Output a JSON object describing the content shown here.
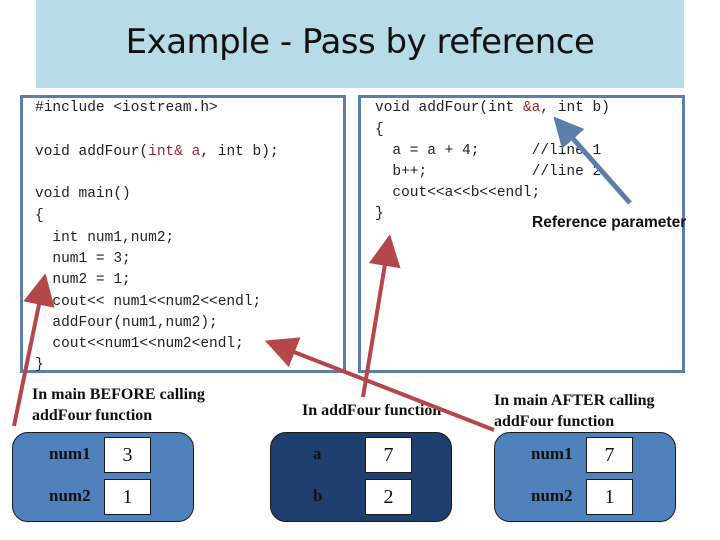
{
  "title": "Example - Pass by reference",
  "left_code": {
    "lines": [
      "#include <iostream.h>",
      "void addFour(",
      "int& a",
      ", int b);",
      "void main()",
      "{",
      "  int num1,num2;",
      "  num1 = 3;",
      "  num2 = 1;",
      "  cout<< num1<<num2<<endl;",
      "  addFour(num1,num2);",
      "  cout<<num1<<num2<endl;",
      "}"
    ]
  },
  "right_code": {
    "sig_prefix": "void addFour(int ",
    "sig_ref": "&a",
    "sig_suffix": ", int b)",
    "lines": [
      "{",
      "  a = a + 4;      //line 1",
      "  b++;            //line 2",
      "  cout<<a<<b<<endl;",
      "}"
    ]
  },
  "annotation": "Reference parameter",
  "captions": {
    "before": [
      "In main BEFORE calling",
      "addFour function"
    ],
    "during": "In addFour function",
    "after": [
      "In main AFTER calling",
      "addFour function"
    ]
  },
  "memory": {
    "before": [
      {
        "name": "num1",
        "value": "3"
      },
      {
        "name": "num2",
        "value": "1"
      }
    ],
    "during": [
      {
        "name": "a",
        "value": "7"
      },
      {
        "name": "b",
        "value": "2"
      }
    ],
    "after": [
      {
        "name": "num1",
        "value": "7"
      },
      {
        "name": "num2",
        "value": "1"
      }
    ]
  },
  "colors": {
    "title_band": "#b7dce8",
    "box_border": "#5b7fa8",
    "memory_light": "#4f81bd",
    "memory_dark": "#1f3f6e",
    "red_arrow": "#b5474b",
    "blue_arrow": "#5b7fa8",
    "ref_keyword": "#a0282c"
  }
}
